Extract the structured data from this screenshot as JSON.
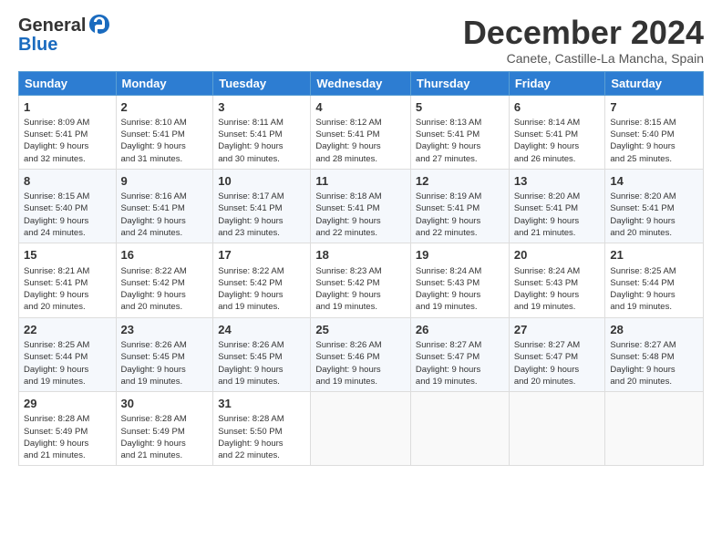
{
  "logo": {
    "line1": "General",
    "line2": "Blue"
  },
  "header": {
    "month": "December 2024",
    "location": "Canete, Castille-La Mancha, Spain"
  },
  "weekdays": [
    "Sunday",
    "Monday",
    "Tuesday",
    "Wednesday",
    "Thursday",
    "Friday",
    "Saturday"
  ],
  "weeks": [
    [
      {
        "day": "1",
        "info": "Sunrise: 8:09 AM\nSunset: 5:41 PM\nDaylight: 9 hours\nand 32 minutes."
      },
      {
        "day": "2",
        "info": "Sunrise: 8:10 AM\nSunset: 5:41 PM\nDaylight: 9 hours\nand 31 minutes."
      },
      {
        "day": "3",
        "info": "Sunrise: 8:11 AM\nSunset: 5:41 PM\nDaylight: 9 hours\nand 30 minutes."
      },
      {
        "day": "4",
        "info": "Sunrise: 8:12 AM\nSunset: 5:41 PM\nDaylight: 9 hours\nand 28 minutes."
      },
      {
        "day": "5",
        "info": "Sunrise: 8:13 AM\nSunset: 5:41 PM\nDaylight: 9 hours\nand 27 minutes."
      },
      {
        "day": "6",
        "info": "Sunrise: 8:14 AM\nSunset: 5:41 PM\nDaylight: 9 hours\nand 26 minutes."
      },
      {
        "day": "7",
        "info": "Sunrise: 8:15 AM\nSunset: 5:40 PM\nDaylight: 9 hours\nand 25 minutes."
      }
    ],
    [
      {
        "day": "8",
        "info": "Sunrise: 8:15 AM\nSunset: 5:40 PM\nDaylight: 9 hours\nand 24 minutes."
      },
      {
        "day": "9",
        "info": "Sunrise: 8:16 AM\nSunset: 5:41 PM\nDaylight: 9 hours\nand 24 minutes."
      },
      {
        "day": "10",
        "info": "Sunrise: 8:17 AM\nSunset: 5:41 PM\nDaylight: 9 hours\nand 23 minutes."
      },
      {
        "day": "11",
        "info": "Sunrise: 8:18 AM\nSunset: 5:41 PM\nDaylight: 9 hours\nand 22 minutes."
      },
      {
        "day": "12",
        "info": "Sunrise: 8:19 AM\nSunset: 5:41 PM\nDaylight: 9 hours\nand 22 minutes."
      },
      {
        "day": "13",
        "info": "Sunrise: 8:20 AM\nSunset: 5:41 PM\nDaylight: 9 hours\nand 21 minutes."
      },
      {
        "day": "14",
        "info": "Sunrise: 8:20 AM\nSunset: 5:41 PM\nDaylight: 9 hours\nand 20 minutes."
      }
    ],
    [
      {
        "day": "15",
        "info": "Sunrise: 8:21 AM\nSunset: 5:41 PM\nDaylight: 9 hours\nand 20 minutes."
      },
      {
        "day": "16",
        "info": "Sunrise: 8:22 AM\nSunset: 5:42 PM\nDaylight: 9 hours\nand 20 minutes."
      },
      {
        "day": "17",
        "info": "Sunrise: 8:22 AM\nSunset: 5:42 PM\nDaylight: 9 hours\nand 19 minutes."
      },
      {
        "day": "18",
        "info": "Sunrise: 8:23 AM\nSunset: 5:42 PM\nDaylight: 9 hours\nand 19 minutes."
      },
      {
        "day": "19",
        "info": "Sunrise: 8:24 AM\nSunset: 5:43 PM\nDaylight: 9 hours\nand 19 minutes."
      },
      {
        "day": "20",
        "info": "Sunrise: 8:24 AM\nSunset: 5:43 PM\nDaylight: 9 hours\nand 19 minutes."
      },
      {
        "day": "21",
        "info": "Sunrise: 8:25 AM\nSunset: 5:44 PM\nDaylight: 9 hours\nand 19 minutes."
      }
    ],
    [
      {
        "day": "22",
        "info": "Sunrise: 8:25 AM\nSunset: 5:44 PM\nDaylight: 9 hours\nand 19 minutes."
      },
      {
        "day": "23",
        "info": "Sunrise: 8:26 AM\nSunset: 5:45 PM\nDaylight: 9 hours\nand 19 minutes."
      },
      {
        "day": "24",
        "info": "Sunrise: 8:26 AM\nSunset: 5:45 PM\nDaylight: 9 hours\nand 19 minutes."
      },
      {
        "day": "25",
        "info": "Sunrise: 8:26 AM\nSunset: 5:46 PM\nDaylight: 9 hours\nand 19 minutes."
      },
      {
        "day": "26",
        "info": "Sunrise: 8:27 AM\nSunset: 5:47 PM\nDaylight: 9 hours\nand 19 minutes."
      },
      {
        "day": "27",
        "info": "Sunrise: 8:27 AM\nSunset: 5:47 PM\nDaylight: 9 hours\nand 20 minutes."
      },
      {
        "day": "28",
        "info": "Sunrise: 8:27 AM\nSunset: 5:48 PM\nDaylight: 9 hours\nand 20 minutes."
      }
    ],
    [
      {
        "day": "29",
        "info": "Sunrise: 8:28 AM\nSunset: 5:49 PM\nDaylight: 9 hours\nand 21 minutes."
      },
      {
        "day": "30",
        "info": "Sunrise: 8:28 AM\nSunset: 5:49 PM\nDaylight: 9 hours\nand 21 minutes."
      },
      {
        "day": "31",
        "info": "Sunrise: 8:28 AM\nSunset: 5:50 PM\nDaylight: 9 hours\nand 22 minutes."
      },
      null,
      null,
      null,
      null
    ]
  ]
}
